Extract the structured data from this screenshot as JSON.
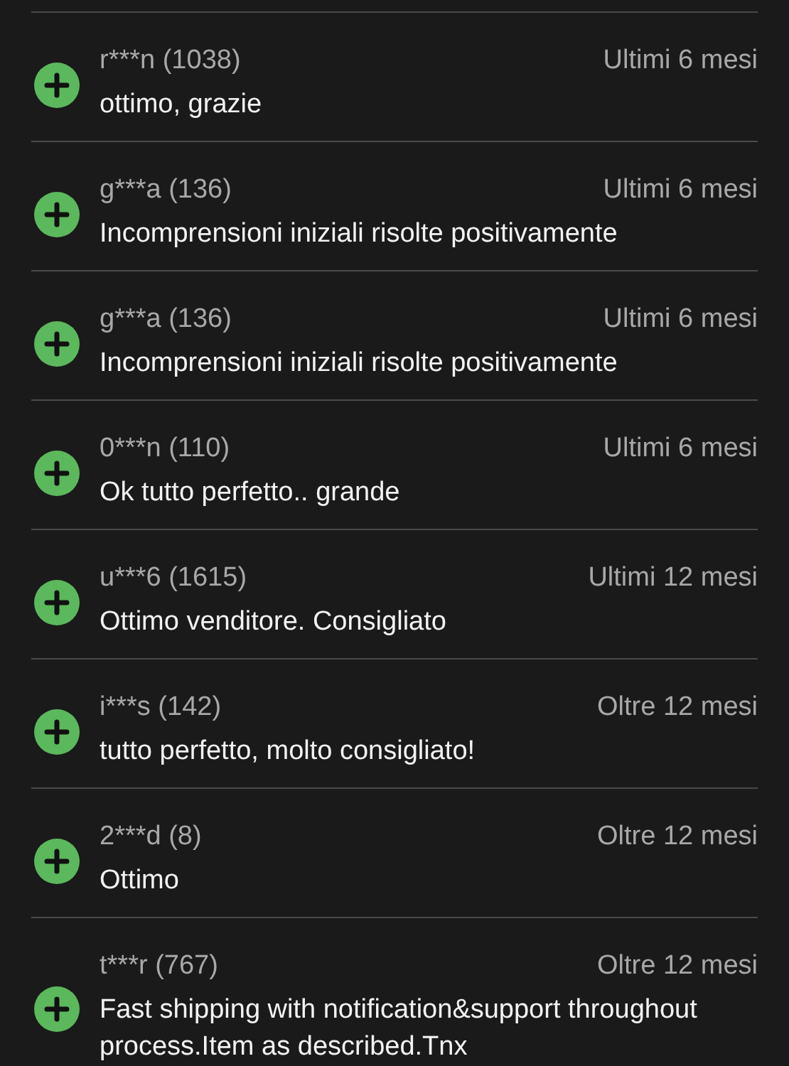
{
  "reviews": [
    {
      "user": "r***n (1038)",
      "period": "Ultimi 6 mesi",
      "comment": "ottimo, grazie",
      "positive": true
    },
    {
      "user": "g***a (136)",
      "period": "Ultimi 6 mesi",
      "comment": "Incomprensioni iniziali risolte positivamente",
      "positive": true
    },
    {
      "user": "g***a (136)",
      "period": "Ultimi 6 mesi",
      "comment": "Incomprensioni iniziali risolte positivamente",
      "positive": true
    },
    {
      "user": "0***n (110)",
      "period": "Ultimi 6 mesi",
      "comment": "Ok tutto perfetto.. grande",
      "positive": true
    },
    {
      "user": "u***6 (1615)",
      "period": "Ultimi 12 mesi",
      "comment": "Ottimo venditore. Consigliato",
      "positive": true
    },
    {
      "user": "i***s (142)",
      "period": "Oltre 12 mesi",
      "comment": "tutto perfetto, molto consigliato!",
      "positive": true
    },
    {
      "user": "2***d (8)",
      "period": "Oltre 12 mesi",
      "comment": "Ottimo",
      "positive": true
    },
    {
      "user": "t***r (767)",
      "period": "Oltre 12 mesi",
      "comment": "Fast shipping with notification&support throughout process.Item as described.Tnx",
      "positive": true
    }
  ]
}
